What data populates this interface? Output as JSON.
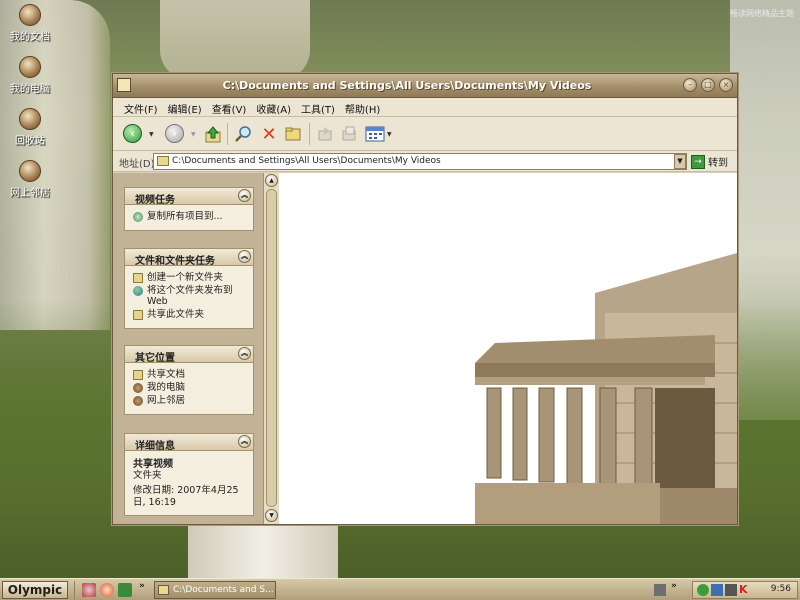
{
  "desktop": {
    "watermark": "畅读网络精品主题",
    "icons": [
      {
        "label": "我的文档"
      },
      {
        "label": "我的电脑"
      },
      {
        "label": "回收站"
      },
      {
        "label": "网上邻居"
      }
    ]
  },
  "window": {
    "title": "C:\\Documents and Settings\\All Users\\Documents\\My Videos",
    "menu": [
      "文件(F)",
      "编辑(E)",
      "查看(V)",
      "收藏(A)",
      "工具(T)",
      "帮助(H)"
    ],
    "address": {
      "label": "地址(D)",
      "value": "C:\\Documents and Settings\\All Users\\Documents\\My Videos",
      "go_label": "转到"
    },
    "task_pane": {
      "video_tasks": {
        "title": "视频任务",
        "items": [
          "复制所有项目到..."
        ]
      },
      "file_tasks": {
        "title": "文件和文件夹任务",
        "items": [
          "创建一个新文件夹",
          "将这个文件夹发布到 Web",
          "共享此文件夹"
        ]
      },
      "other_places": {
        "title": "其它位置",
        "items": [
          "共享文档",
          "我的电脑",
          "网上邻居"
        ]
      },
      "details": {
        "title": "详细信息",
        "name": "共享视频",
        "type": "文件夹",
        "modified": "修改日期: 2007年4月25日, 16:19"
      }
    }
  },
  "taskbar": {
    "start_label": "Olympic",
    "window_button": "C:\\Documents and S...",
    "chevron": "»",
    "clock": "9:56"
  },
  "colors": {
    "frame": "#a58f6a",
    "pane": "#c2b396",
    "taskbar": "#c7b58f"
  }
}
